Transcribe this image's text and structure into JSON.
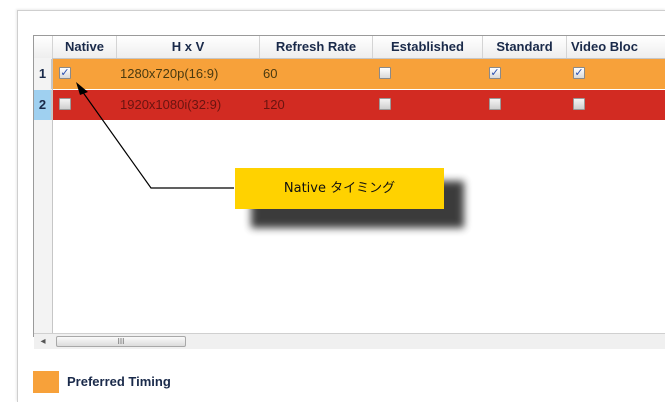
{
  "table": {
    "columns": [
      "Native",
      "H x V",
      "Refresh Rate",
      "Established",
      "Standard",
      "Video Bloc"
    ],
    "rows": [
      {
        "num": "1",
        "resolution": "1280x720p(16:9)",
        "refresh": "60",
        "native": true,
        "established": false,
        "standard": true,
        "video_block": true
      },
      {
        "num": "2",
        "resolution": "1920x1080i(32:9)",
        "refresh": "120",
        "native": false,
        "established": false,
        "standard": false,
        "video_block": false
      }
    ]
  },
  "scrollbar": {
    "left_arrow": "◂",
    "thumb_grip": "III"
  },
  "legend": {
    "label": "Preferred Timing"
  },
  "callout": {
    "text": "Native タイミング"
  },
  "colors": {
    "preferred_row": "#f7a13a",
    "other_row": "#d22b22",
    "callout_bg": "#ffd200",
    "selected_row_header": "#9fd0f0"
  }
}
